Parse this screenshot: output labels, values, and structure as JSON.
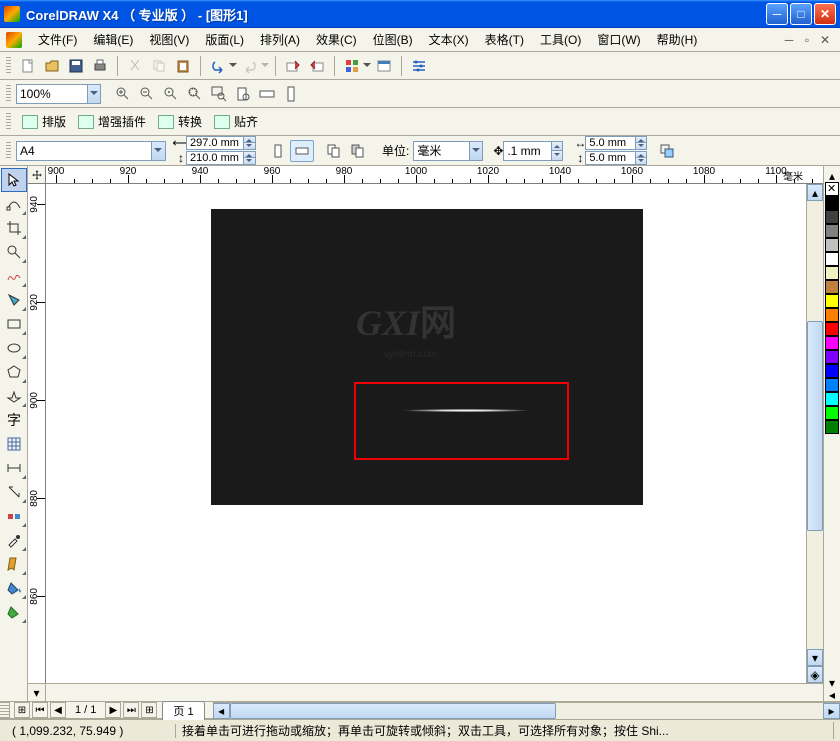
{
  "title": "CorelDRAW X4 （ 专业版 ） - [图形1]",
  "menu": {
    "items": [
      "文件(F)",
      "编辑(E)",
      "视图(V)",
      "版面(L)",
      "排列(A)",
      "效果(C)",
      "位图(B)",
      "文本(X)",
      "表格(T)",
      "工具(O)",
      "窗口(W)",
      "帮助(H)"
    ]
  },
  "zoom": {
    "value": "100%"
  },
  "toolbar_row4": {
    "items": [
      "排版",
      "增强插件",
      "转换",
      "贴齐"
    ]
  },
  "propbar": {
    "paper": "A4",
    "width": "297.0 mm",
    "height": "210.0 mm",
    "units_label": "单位:",
    "units": "毫米",
    "nudge": ".1 mm",
    "dup_x": "5.0 mm",
    "dup_y": "5.0 mm"
  },
  "ruler": {
    "h_ticks": [
      "900",
      "920",
      "940",
      "960",
      "980",
      "1000",
      "1020",
      "1040",
      "1060",
      "1080",
      "1100"
    ],
    "h_unit": "毫米",
    "v_ticks": [
      "940",
      "920",
      "900",
      "880",
      "860"
    ]
  },
  "palette_colors": [
    "#000000",
    "#404040",
    "#808080",
    "#c0c0c0",
    "#ffffff",
    "#f0f0c0",
    "#c08040",
    "#ffff00",
    "#ff8000",
    "#ff0000",
    "#ff00ff",
    "#8000ff",
    "#0000ff",
    "#0080ff",
    "#00ffff",
    "#00ff00",
    "#008000"
  ],
  "pagenav": {
    "info": "1 / 1",
    "tab": "页 1"
  },
  "status": {
    "coords": "( 1,099.232, 75.949 )",
    "hint": "接着单击可进行拖动或缩放；再单击可旋转或倾斜；双击工具，可选择所有对象；按住 Shi..."
  },
  "watermark": {
    "big": "GXI",
    "net": "网",
    "sub": "system.com"
  }
}
